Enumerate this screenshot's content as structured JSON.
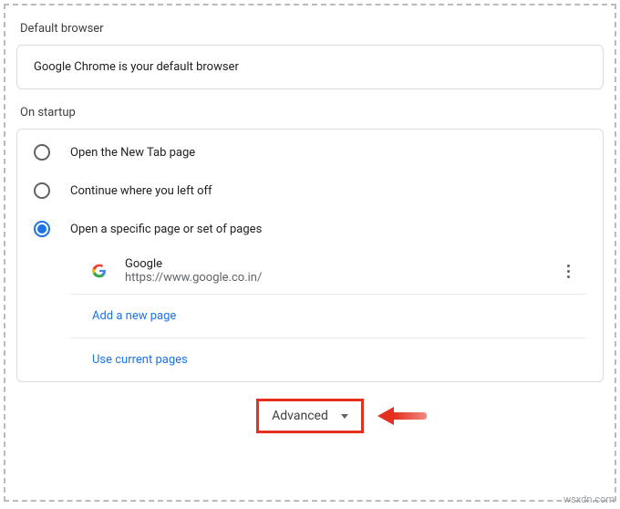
{
  "defaultBrowser": {
    "heading": "Default browser",
    "status": "Google Chrome is your default browser"
  },
  "startup": {
    "heading": "On startup",
    "options": {
      "newtab": "Open the New Tab page",
      "continue": "Continue where you left off",
      "specific": "Open a specific page or set of pages"
    },
    "pages": [
      {
        "title": "Google",
        "url": "https://www.google.co.in/"
      }
    ],
    "addPage": "Add a new page",
    "useCurrent": "Use current pages"
  },
  "advanced": "Advanced",
  "watermark": "wsxdn.com"
}
